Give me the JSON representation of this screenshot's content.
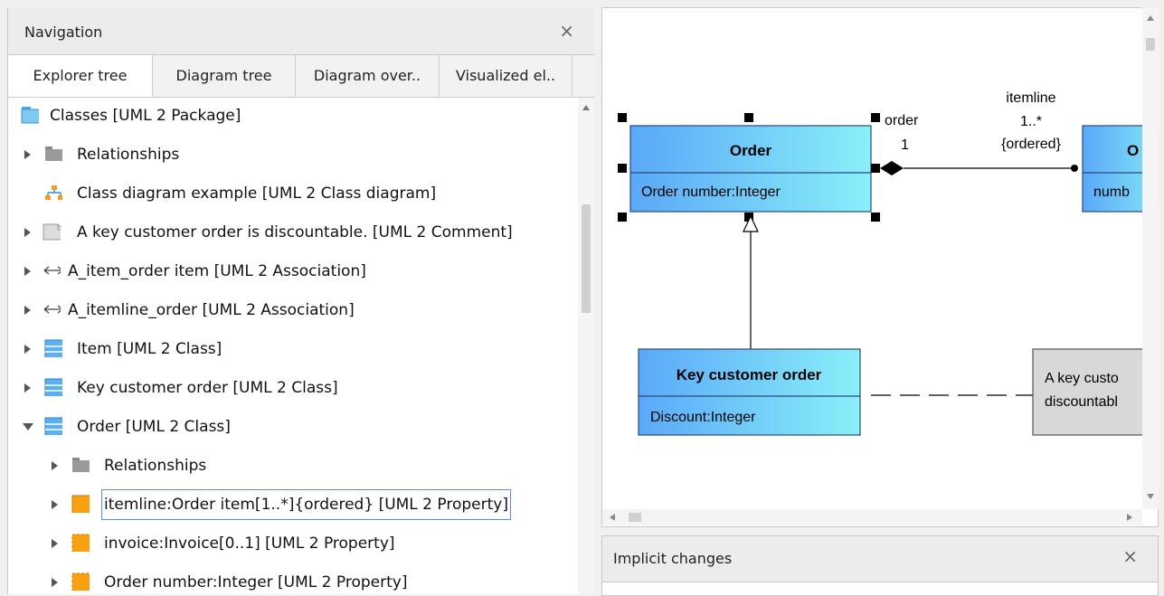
{
  "navigation": {
    "title": "Navigation",
    "close": "×",
    "tabs": [
      {
        "label": "Explorer tree",
        "active": true
      },
      {
        "label": "Diagram tree",
        "active": false
      },
      {
        "label": "Diagram over..",
        "active": false
      },
      {
        "label": "Visualized el..",
        "active": false
      }
    ],
    "tree": [
      {
        "label": "Classes [UML 2 Package]",
        "icon": "package-icon"
      },
      {
        "label": "Relationships",
        "icon": "folder-icon"
      },
      {
        "label": "Class diagram example [UML 2 Class diagram]",
        "icon": "class-diagram-icon"
      },
      {
        "label": "A key customer order is discountable. [UML 2 Comment]",
        "icon": "comment-icon"
      },
      {
        "label": "A_item_order item [UML 2 Association]",
        "icon": "association-icon"
      },
      {
        "label": "A_itemline_order [UML 2 Association]",
        "icon": "association-icon"
      },
      {
        "label": "Item [UML 2 Class]",
        "icon": "class-icon"
      },
      {
        "label": "Key customer order [UML 2 Class]",
        "icon": "class-icon"
      },
      {
        "label": "Order [UML 2 Class]",
        "icon": "class-icon"
      },
      {
        "label": "Relationships",
        "icon": "folder-icon"
      },
      {
        "label": "itemline:Order item[1..*]{ordered} [UML 2 Property]",
        "icon": "property-icon"
      },
      {
        "label": "invoice:Invoice[0..1] [UML 2 Property]",
        "icon": "property-icon"
      },
      {
        "label": "Order number:Integer [UML 2 Property]",
        "icon": "property-icon"
      }
    ]
  },
  "diagram": {
    "order_class": {
      "name": "Order",
      "attribute": "Order number:Integer"
    },
    "key_customer_class": {
      "name": "Key customer order",
      "attribute": "Discount:Integer"
    },
    "order_item_class": {
      "name": "O",
      "attribute": "numb"
    },
    "comment_text": [
      "A key custo",
      "discountabl"
    ],
    "association_labels": {
      "role_left": "order",
      "mult_left": "1",
      "role_right": "itemline",
      "mult_right": "1..*",
      "constraint": "{ordered}"
    },
    "colors": {
      "class_top": "#5aa8f8",
      "class_bottom": "#8af0f8",
      "comment": "#d8d8d8",
      "border": "#2a4a7a"
    }
  },
  "implicit_changes": {
    "title": "Implicit changes",
    "close": "×"
  }
}
